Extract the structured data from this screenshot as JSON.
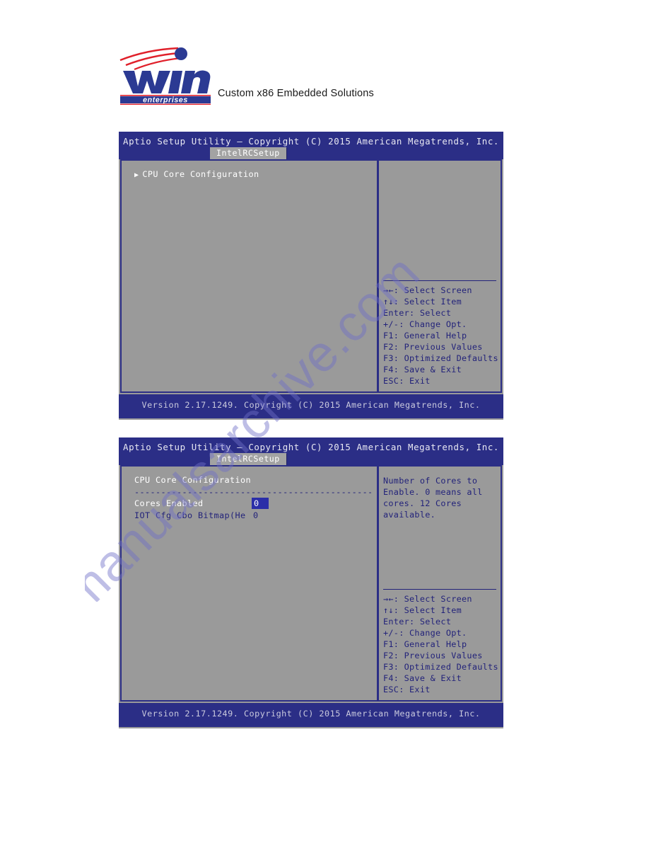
{
  "header": {
    "logo_name": "win enterprises",
    "logo_word_main": "win",
    "logo_word_sub": "enterprises",
    "tagline": "Custom x86 Embedded Solutions",
    "brand_blue": "#2b3a93",
    "brand_red": "#e0202a"
  },
  "watermark": {
    "text": "manualsarchive.com"
  },
  "screens": [
    {
      "title": "Aptio Setup Utility – Copyright (C) 2015 American Megatrends, Inc.",
      "tab": "IntelRCSetup",
      "menu_items": [
        {
          "marker": "▶",
          "label": "CPU Core Configuration"
        }
      ],
      "help_text": "",
      "help_keys": [
        "→←: Select Screen",
        "↑↓: Select Item",
        "Enter: Select",
        "+/-: Change Opt.",
        "F1: General Help",
        "F2: Previous Values",
        "F3: Optimized Defaults",
        "F4: Save & Exit",
        "ESC: Exit"
      ],
      "footer": "Version 2.17.1249. Copyright (C) 2015 American Megatrends, Inc."
    },
    {
      "title": "Aptio Setup Utility – Copyright (C) 2015 American Megatrends, Inc.",
      "tab": "IntelRCSetup",
      "section_title": "CPU Core Configuration",
      "dash_rule": "-------------------------------------------------...",
      "settings": [
        {
          "label": "Cores Enabled",
          "value": "0",
          "selected": true
        },
        {
          "label": "IOT Cfg Cbo Bitmap(He",
          "value": "0",
          "selected": false
        }
      ],
      "help_text": "Number of Cores to Enable. 0 means all cores. 12 Cores available.",
      "help_keys": [
        "→←: Select Screen",
        "↑↓: Select Item",
        "Enter: Select",
        "+/-: Change Opt.",
        "F1: General Help",
        "F2: Previous Values",
        "F3: Optimized Defaults",
        "F4: Save & Exit",
        "ESC: Exit"
      ],
      "footer": "Version 2.17.1249. Copyright (C) 2015 American Megatrends, Inc."
    }
  ]
}
